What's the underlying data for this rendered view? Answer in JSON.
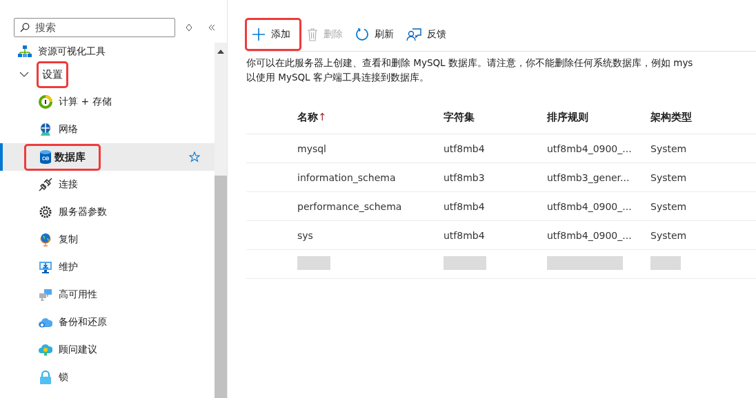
{
  "sidebar": {
    "search": {
      "placeholder": "搜索"
    },
    "items": [
      {
        "label": "资源可视化工具",
        "selected": false,
        "highlighted": false
      },
      {
        "label": "设置",
        "expanded": true,
        "selected": false,
        "highlighted": true,
        "children": [
          {
            "label": "计算 + 存储",
            "selected": false,
            "highlighted": false
          },
          {
            "label": "网络",
            "selected": false,
            "highlighted": false
          },
          {
            "label": "数据库",
            "selected": true,
            "highlighted": true,
            "favorite": false
          },
          {
            "label": "连接",
            "selected": false,
            "highlighted": false
          },
          {
            "label": "服务器参数",
            "selected": false,
            "highlighted": false
          },
          {
            "label": "复制",
            "selected": false,
            "highlighted": false
          },
          {
            "label": "维护",
            "selected": false,
            "highlighted": false
          },
          {
            "label": "高可用性",
            "selected": false,
            "highlighted": false
          },
          {
            "label": "备份和还原",
            "selected": false,
            "highlighted": false
          },
          {
            "label": "顾问建议",
            "selected": false,
            "highlighted": false
          },
          {
            "label": "锁",
            "selected": false,
            "highlighted": false
          }
        ]
      }
    ]
  },
  "toolbar": [
    {
      "label": "添加",
      "disabled": false,
      "highlighted": true
    },
    {
      "label": "删除",
      "disabled": true,
      "highlighted": false
    },
    {
      "label": "刷新",
      "disabled": false,
      "highlighted": false
    },
    {
      "label": "反馈",
      "disabled": false,
      "highlighted": false
    }
  ],
  "description": "你可以在此服务器上创建、查看和删除 MySQL 数据库。请注意，你不能删除任何系统数据库，例如 mys\n以使用 MySQL 客户端工具连接到数据库。",
  "table": {
    "columns": [
      {
        "label": "名称",
        "sort_mark": "↑"
      },
      {
        "label": "字符集"
      },
      {
        "label": "排序规则"
      },
      {
        "label": "架构类型"
      }
    ],
    "rows": [
      {
        "kind": "data",
        "cells": [
          "mysql",
          "utf8mb4",
          "utf8mb4_0900_...",
          "System"
        ]
      },
      {
        "kind": "data",
        "cells": [
          "information_schema",
          "utf8mb3",
          "utf8mb3_gener...",
          "System"
        ]
      },
      {
        "kind": "data",
        "cells": [
          "performance_schema",
          "utf8mb4",
          "utf8mb4_0900_...",
          "System"
        ]
      },
      {
        "kind": "data",
        "cells": [
          "sys",
          "utf8mb4",
          "utf8mb4_0900_...",
          "System"
        ]
      },
      {
        "kind": "redacted"
      }
    ]
  }
}
